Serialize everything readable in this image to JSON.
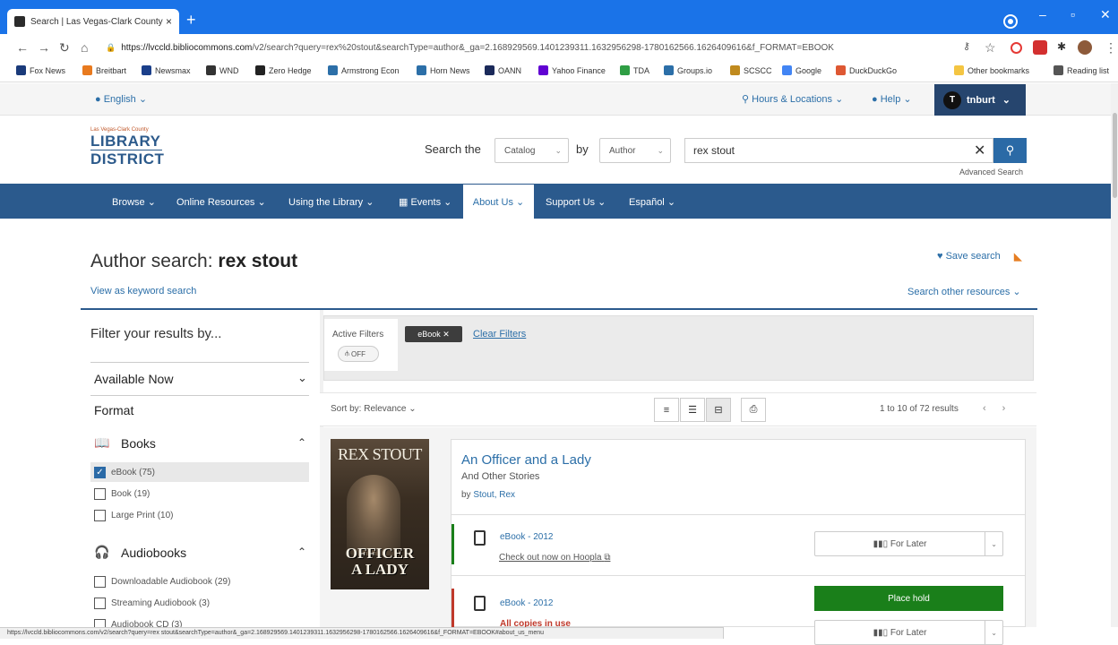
{
  "browser": {
    "tab_title": "Search | Las Vegas-Clark County",
    "tab_close": "×",
    "new_tab": "+",
    "url_host": "https://lvccld.bibliocommons.com",
    "url_path": "/v2/search?query=rex%20stout&searchType=author&_ga=2.168929569.1401239311.1632956298-1780162566.1626409616&f_FORMAT=EBOOK",
    "status_url": "https://lvccld.bibliocommons.com/v2/search?query=rex stout&searchType=author&_ga=2.168929569.1401239311.1632956298-1780162566.1626409616&f_FORMAT=EBOOK#about_us_menu",
    "bookmarks": [
      {
        "label": "Fox News",
        "color": "#1a3a7a"
      },
      {
        "label": "Breitbart",
        "color": "#e87a1e"
      },
      {
        "label": "Newsmax",
        "color": "#1b3f8a"
      },
      {
        "label": "WND",
        "color": "#333333"
      },
      {
        "label": "Zero Hedge",
        "color": "#222222"
      },
      {
        "label": "Armstrong Econ",
        "color": "#2c6fa8"
      },
      {
        "label": "Horn News",
        "color": "#2c6fa8"
      },
      {
        "label": "OANN",
        "color": "#1b2a5a"
      },
      {
        "label": "Yahoo Finance",
        "color": "#6001d2"
      },
      {
        "label": "TDA",
        "color": "#2f9e44"
      },
      {
        "label": "Groups.io",
        "color": "#2c6fa8"
      },
      {
        "label": "SCSCC",
        "color": "#c08a1e"
      },
      {
        "label": "Google",
        "color": "#4285f4"
      },
      {
        "label": "DuckDuckGo",
        "color": "#de5833"
      },
      {
        "label": "Other bookmarks",
        "color": "#f4c542"
      },
      {
        "label": "Reading list",
        "color": "#555555"
      }
    ]
  },
  "site": {
    "language": "English",
    "hours": "Hours & Locations",
    "help": "Help",
    "user": {
      "initial": "T",
      "name": "tnburt"
    },
    "logo": {
      "small": "Las Vegas-Clark County",
      "line1": "LIBRARY",
      "line2": "DISTRICT"
    },
    "search": {
      "label": "Search the",
      "scope": "Catalog",
      "by": "by",
      "type": "Author",
      "query": "rex stout",
      "advanced": "Advanced Search"
    },
    "nav": [
      {
        "label": "Browse"
      },
      {
        "label": "Online Resources"
      },
      {
        "label": "Using the Library"
      },
      {
        "label": "Events"
      },
      {
        "label": "About Us"
      },
      {
        "label": "Support Us"
      },
      {
        "label": "Español"
      }
    ],
    "page": {
      "title_prefix": "Author search:",
      "title_query": "rex stout",
      "view_keyword": "View as keyword search",
      "save_search": "Save search",
      "search_other": "Search other resources"
    },
    "filters": {
      "heading": "Filter your results by...",
      "available_now": "Available Now",
      "format": "Format",
      "books": {
        "label": "Books",
        "items": [
          {
            "label": "eBook (75)",
            "checked": true
          },
          {
            "label": "Book (19)",
            "checked": false
          },
          {
            "label": "Large Print (10)",
            "checked": false
          }
        ]
      },
      "audiobooks": {
        "label": "Audiobooks",
        "items": [
          {
            "label": "Downloadable Audiobook (29)",
            "checked": false
          },
          {
            "label": "Streaming Audiobook (3)",
            "checked": false
          },
          {
            "label": "Audiobook CD (3)",
            "checked": false
          }
        ]
      }
    },
    "active_filters": {
      "label": "Active Filters",
      "toggle": "OFF",
      "chip": "eBook",
      "clear": "Clear Filters"
    },
    "results_bar": {
      "sort": "Sort by: Relevance",
      "count": "1 to 10 of 72 results"
    },
    "result": {
      "cover_author": "REX STOUT",
      "cover_title1": "OFFICER",
      "cover_title2": "A LADY",
      "title": "An Officer and a Lady",
      "subtitle": "And Other Stories",
      "author_prefix": "by",
      "author": "Stout, Rex",
      "editions": [
        {
          "format": "eBook - 2012",
          "action": "Check out now on Hoopla",
          "status_color": "#1a7f1a",
          "button": "For Later"
        },
        {
          "format": "eBook - 2012",
          "status": "All copies in use",
          "status_color": "#c0392b",
          "primary_button": "Place hold",
          "button": "For Later"
        }
      ]
    }
  }
}
